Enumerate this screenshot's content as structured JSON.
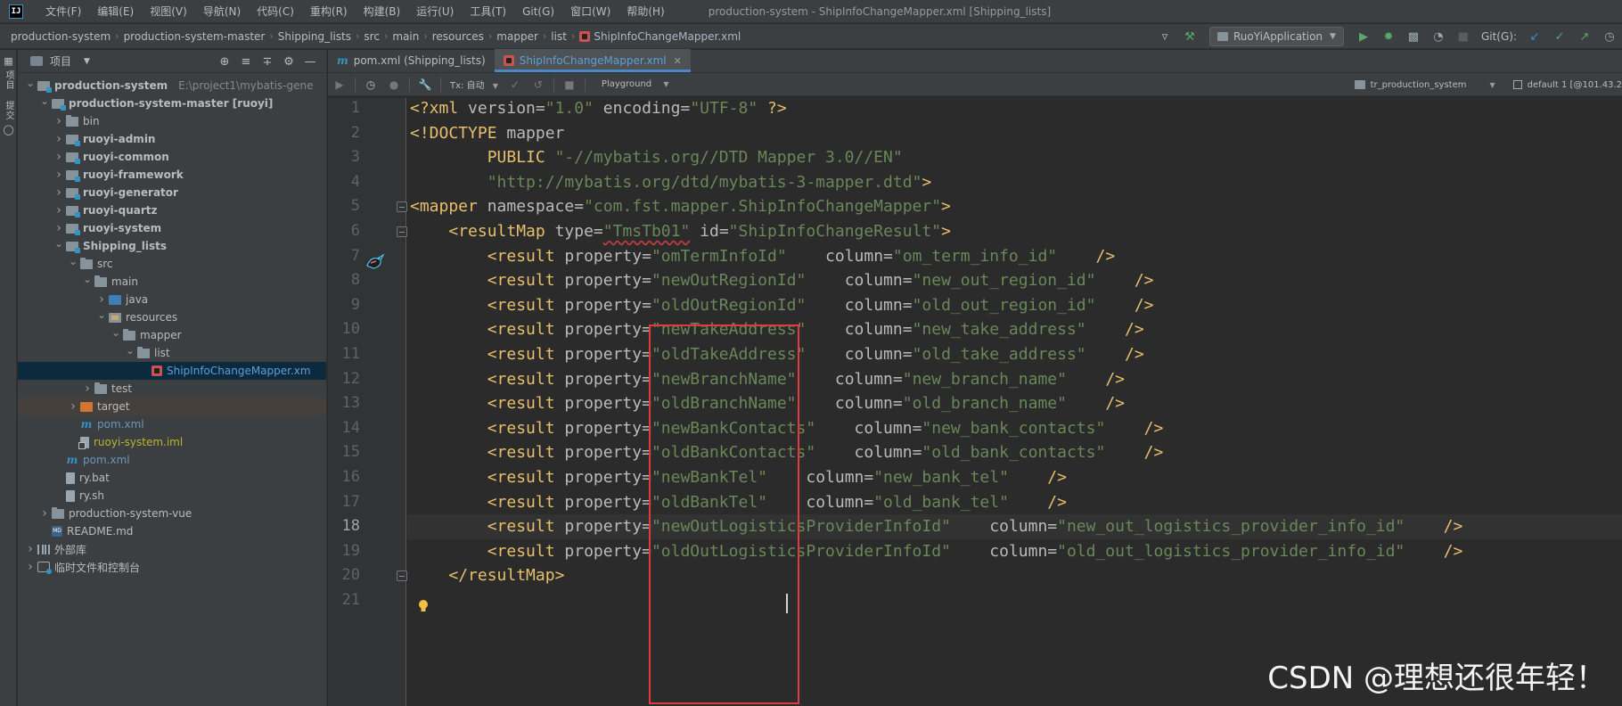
{
  "menubar": {
    "logo": "IJ",
    "items": [
      "文件(F)",
      "编辑(E)",
      "视图(V)",
      "导航(N)",
      "代码(C)",
      "重构(R)",
      "构建(B)",
      "运行(U)",
      "工具(T)",
      "Git(G)",
      "窗口(W)",
      "帮助(H)"
    ],
    "window_title": "production-system - ShipInfoChangeMapper.xml [Shipping_lists]"
  },
  "breadcrumbs": [
    "production-system",
    "production-system-master",
    "Shipping_lists",
    "src",
    "main",
    "resources",
    "mapper",
    "list",
    "ShipInfoChangeMapper.xml"
  ],
  "toolbar": {
    "run_config": "RuoYiApplication",
    "git_label": "Git(G):"
  },
  "left_strip": {
    "tab1": "项目",
    "tab2": "提交"
  },
  "project_panel": {
    "title": "项目",
    "tree": [
      {
        "label": "production-system",
        "path": "E:\\project1\\mybatis-gene",
        "icon": "module",
        "depth": 0,
        "arrow": "open",
        "bold": true
      },
      {
        "label": "production-system-master [ruoyi]",
        "icon": "module",
        "depth": 1,
        "arrow": "open",
        "bold": true
      },
      {
        "label": "bin",
        "icon": "folder",
        "depth": 2,
        "arrow": "closed"
      },
      {
        "label": "ruoyi-admin",
        "icon": "module",
        "depth": 2,
        "arrow": "closed",
        "bold": true
      },
      {
        "label": "ruoyi-common",
        "icon": "module",
        "depth": 2,
        "arrow": "closed",
        "bold": true
      },
      {
        "label": "ruoyi-framework",
        "icon": "module",
        "depth": 2,
        "arrow": "closed",
        "bold": true
      },
      {
        "label": "ruoyi-generator",
        "icon": "module",
        "depth": 2,
        "arrow": "closed",
        "bold": true
      },
      {
        "label": "ruoyi-quartz",
        "icon": "module",
        "depth": 2,
        "arrow": "closed",
        "bold": true
      },
      {
        "label": "ruoyi-system",
        "icon": "module",
        "depth": 2,
        "arrow": "closed",
        "bold": true
      },
      {
        "label": "Shipping_lists",
        "icon": "module",
        "depth": 2,
        "arrow": "open",
        "bold": true
      },
      {
        "label": "src",
        "icon": "folder",
        "depth": 3,
        "arrow": "open"
      },
      {
        "label": "main",
        "icon": "folder",
        "depth": 4,
        "arrow": "open"
      },
      {
        "label": "java",
        "icon": "src",
        "depth": 5,
        "arrow": "closed"
      },
      {
        "label": "resources",
        "icon": "res",
        "depth": 5,
        "arrow": "open"
      },
      {
        "label": "mapper",
        "icon": "folder",
        "depth": 6,
        "arrow": "open"
      },
      {
        "label": "list",
        "icon": "folder",
        "depth": 7,
        "arrow": "open"
      },
      {
        "label": "ShipInfoChangeMapper.xm",
        "icon": "xml",
        "depth": 8,
        "arrow": "none",
        "color": "xml-file",
        "state": "selected"
      },
      {
        "label": "test",
        "icon": "folder",
        "depth": 4,
        "arrow": "closed"
      },
      {
        "label": "target",
        "icon": "target",
        "depth": 3,
        "arrow": "closed",
        "state": "excluded"
      },
      {
        "label": "pom.xml",
        "icon": "m",
        "depth": 3,
        "arrow": "none",
        "color": "blue"
      },
      {
        "label": "ruoyi-system.iml",
        "icon": "iml",
        "depth": 3,
        "arrow": "none",
        "color": "yellowish"
      },
      {
        "label": "pom.xml",
        "icon": "m",
        "depth": 2,
        "arrow": "none",
        "color": "blue"
      },
      {
        "label": "ry.bat",
        "icon": "file",
        "depth": 2,
        "arrow": "none"
      },
      {
        "label": "ry.sh",
        "icon": "file",
        "depth": 2,
        "arrow": "none"
      },
      {
        "label": "production-system-vue",
        "icon": "folder",
        "depth": 1,
        "arrow": "closed"
      },
      {
        "label": "README.md",
        "icon": "md",
        "depth": 1,
        "arrow": "none"
      },
      {
        "label": "外部库",
        "icon": "lib",
        "depth": 0,
        "arrow": "closed"
      },
      {
        "label": "临时文件和控制台",
        "icon": "scratch",
        "depth": 0,
        "arrow": "closed"
      }
    ]
  },
  "editor": {
    "tabs": [
      {
        "label": "pom.xml (Shipping_lists)",
        "icon": "m",
        "active": false
      },
      {
        "label": "ShipInfoChangeMapper.xml",
        "icon": "xml",
        "active": true
      }
    ],
    "db_toolbar": {
      "tx_mode": "Tx: 自动",
      "playground": "Playground",
      "schema": "tr_production_system",
      "session": "default 1 [@101.43.2"
    },
    "current_line": 18,
    "lines": [
      [
        [
          "tag",
          "<?xml "
        ],
        [
          "attr",
          "version="
        ],
        [
          "str",
          "\"1.0\""
        ],
        [
          "txt",
          " "
        ],
        [
          "attr",
          "encoding="
        ],
        [
          "str",
          "\"UTF-8\""
        ],
        [
          "txt",
          " "
        ],
        [
          "tag",
          "?>"
        ]
      ],
      [
        [
          "tag",
          "<!DOCTYPE "
        ],
        [
          "attr",
          "mapper"
        ]
      ],
      [
        [
          "txt",
          "        "
        ],
        [
          "tag",
          "PUBLIC "
        ],
        [
          "str",
          "\"-//mybatis.org//DTD Mapper 3.0//EN\""
        ]
      ],
      [
        [
          "txt",
          "        "
        ],
        [
          "str",
          "\"http://mybatis.org/dtd/mybatis-3-mapper.dtd\""
        ],
        [
          "tag",
          ">"
        ]
      ],
      [
        [
          "tag",
          "<mapper "
        ],
        [
          "attr",
          "namespace="
        ],
        [
          "str",
          "\"com.fst.mapper.ShipInfoChangeMapper\""
        ],
        [
          "tag",
          ">"
        ]
      ],
      [
        [
          "txt",
          "    "
        ],
        [
          "tag",
          "<resultMap "
        ],
        [
          "attr",
          "type="
        ],
        [
          "strerr",
          "\"TmsTb01\""
        ],
        [
          "txt",
          " "
        ],
        [
          "attr",
          "id="
        ],
        [
          "str",
          "\"ShipInfoChangeResult\""
        ],
        [
          "tag",
          ">"
        ]
      ],
      [
        [
          "txt",
          "        "
        ],
        [
          "tag",
          "<result "
        ],
        [
          "attr",
          "property="
        ],
        [
          "str",
          "\"omTermInfoId\""
        ],
        [
          "txt",
          "    "
        ],
        [
          "attr",
          "column="
        ],
        [
          "str",
          "\"om_term_info_id\""
        ],
        [
          "txt",
          "    "
        ],
        [
          "tag",
          "/>"
        ]
      ],
      [
        [
          "txt",
          "        "
        ],
        [
          "tag",
          "<result "
        ],
        [
          "attr",
          "property="
        ],
        [
          "str",
          "\"newOutRegionId\""
        ],
        [
          "txt",
          "    "
        ],
        [
          "attr",
          "column="
        ],
        [
          "str",
          "\"new_out_region_id\""
        ],
        [
          "txt",
          "    "
        ],
        [
          "tag",
          "/>"
        ]
      ],
      [
        [
          "txt",
          "        "
        ],
        [
          "tag",
          "<result "
        ],
        [
          "attr",
          "property="
        ],
        [
          "str",
          "\"oldOutRegionId\""
        ],
        [
          "txt",
          "    "
        ],
        [
          "attr",
          "column="
        ],
        [
          "str",
          "\"old_out_region_id\""
        ],
        [
          "txt",
          "    "
        ],
        [
          "tag",
          "/>"
        ]
      ],
      [
        [
          "txt",
          "        "
        ],
        [
          "tag",
          "<result "
        ],
        [
          "attr",
          "property="
        ],
        [
          "str",
          "\"newTakeAddress\""
        ],
        [
          "txt",
          "    "
        ],
        [
          "attr",
          "column="
        ],
        [
          "str",
          "\"new_take_address\""
        ],
        [
          "txt",
          "    "
        ],
        [
          "tag",
          "/>"
        ]
      ],
      [
        [
          "txt",
          "        "
        ],
        [
          "tag",
          "<result "
        ],
        [
          "attr",
          "property="
        ],
        [
          "str",
          "\"oldTakeAddress\""
        ],
        [
          "txt",
          "    "
        ],
        [
          "attr",
          "column="
        ],
        [
          "str",
          "\"old_take_address\""
        ],
        [
          "txt",
          "    "
        ],
        [
          "tag",
          "/>"
        ]
      ],
      [
        [
          "txt",
          "        "
        ],
        [
          "tag",
          "<result "
        ],
        [
          "attr",
          "property="
        ],
        [
          "str",
          "\"newBranchName\""
        ],
        [
          "txt",
          "    "
        ],
        [
          "attr",
          "column="
        ],
        [
          "str",
          "\"new_branch_name\""
        ],
        [
          "txt",
          "    "
        ],
        [
          "tag",
          "/>"
        ]
      ],
      [
        [
          "txt",
          "        "
        ],
        [
          "tag",
          "<result "
        ],
        [
          "attr",
          "property="
        ],
        [
          "str",
          "\"oldBranchName\""
        ],
        [
          "txt",
          "    "
        ],
        [
          "attr",
          "column="
        ],
        [
          "str",
          "\"old_branch_name\""
        ],
        [
          "txt",
          "    "
        ],
        [
          "tag",
          "/>"
        ]
      ],
      [
        [
          "txt",
          "        "
        ],
        [
          "tag",
          "<result "
        ],
        [
          "attr",
          "property="
        ],
        [
          "str",
          "\"newBankContacts\""
        ],
        [
          "txt",
          "    "
        ],
        [
          "attr",
          "column="
        ],
        [
          "str",
          "\"new_bank_contacts\""
        ],
        [
          "txt",
          "    "
        ],
        [
          "tag",
          "/>"
        ]
      ],
      [
        [
          "txt",
          "        "
        ],
        [
          "tag",
          "<result "
        ],
        [
          "attr",
          "property="
        ],
        [
          "str",
          "\"oldBankContacts\""
        ],
        [
          "txt",
          "    "
        ],
        [
          "attr",
          "column="
        ],
        [
          "str",
          "\"old_bank_contacts\""
        ],
        [
          "txt",
          "    "
        ],
        [
          "tag",
          "/>"
        ]
      ],
      [
        [
          "txt",
          "        "
        ],
        [
          "tag",
          "<result "
        ],
        [
          "attr",
          "property="
        ],
        [
          "str",
          "\"newBankTel\""
        ],
        [
          "txt",
          "    "
        ],
        [
          "attr",
          "column="
        ],
        [
          "str",
          "\"new_bank_tel\""
        ],
        [
          "txt",
          "    "
        ],
        [
          "tag",
          "/>"
        ]
      ],
      [
        [
          "txt",
          "        "
        ],
        [
          "tag",
          "<result "
        ],
        [
          "attr",
          "property="
        ],
        [
          "str",
          "\"oldBankTel\""
        ],
        [
          "txt",
          "    "
        ],
        [
          "attr",
          "column="
        ],
        [
          "str",
          "\"old_bank_tel\""
        ],
        [
          "txt",
          "    "
        ],
        [
          "tag",
          "/>"
        ]
      ],
      [
        [
          "txt",
          "        "
        ],
        [
          "tag",
          "<result "
        ],
        [
          "attr",
          "property="
        ],
        [
          "str",
          "\"newOutLogisticsProviderInfoId\""
        ],
        [
          "txt",
          "    "
        ],
        [
          "attr",
          "column="
        ],
        [
          "str",
          "\"new_out_logistics_provider_info_id\""
        ],
        [
          "txt",
          "    "
        ],
        [
          "tag",
          "/>"
        ]
      ],
      [
        [
          "txt",
          "        "
        ],
        [
          "tag",
          "<result "
        ],
        [
          "attr",
          "property="
        ],
        [
          "str",
          "\"oldOutLogisticsProviderInfoId\""
        ],
        [
          "txt",
          "    "
        ],
        [
          "attr",
          "column="
        ],
        [
          "str",
          "\"old_out_logistics_provider_info_id\""
        ],
        [
          "txt",
          "    "
        ],
        [
          "tag",
          "/>"
        ]
      ],
      [
        [
          "txt",
          "    "
        ],
        [
          "tag",
          "</resultMap>"
        ]
      ],
      [
        [
          "txt",
          ""
        ]
      ]
    ],
    "colors": {
      "tag": "#e8bf6a",
      "attribute": "#bababa",
      "string": "#6a8759",
      "annotation_box": "#e03a3a"
    }
  },
  "watermark": "CSDN @理想还很年轻！"
}
